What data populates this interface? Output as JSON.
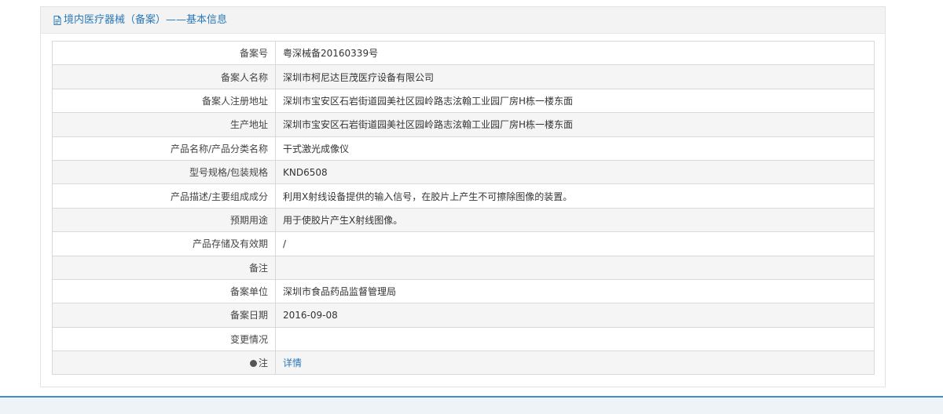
{
  "header": {
    "title": "境内医疗器械（备案）——基本信息",
    "icon": "document-icon",
    "title_color": "#2a78b8"
  },
  "rows": [
    {
      "label": "备案号",
      "value": "粤深械备20160339号"
    },
    {
      "label": "备案人名称",
      "value": "深圳市柯尼达巨茂医疗设备有限公司"
    },
    {
      "label": "备案人注册地址",
      "value": "深圳市宝安区石岩街道园美社区园岭路志泫翰工业园厂房H栋一楼东面"
    },
    {
      "label": "生产地址",
      "value": "深圳市宝安区石岩街道园美社区园岭路志泫翰工业园厂房H栋一楼东面"
    },
    {
      "label": "产品名称/产品分类名称",
      "value": "干式激光成像仪"
    },
    {
      "label": "型号规格/包装规格",
      "value": "KND6508"
    },
    {
      "label": "产品描述/主要组成成分",
      "value": "利用X射线设备提供的输入信号，在胶片上产生不可擦除图像的装置。"
    },
    {
      "label": "预期用途",
      "value": "用于使胶片产生X射线图像。"
    },
    {
      "label": "产品存储及有效期",
      "value": "/"
    },
    {
      "label": "备注",
      "value": ""
    },
    {
      "label": "备案单位",
      "value": "深圳市食品药品监督管理局"
    },
    {
      "label": "备案日期",
      "value": "2016-09-08"
    },
    {
      "label": "变更情况",
      "value": ""
    }
  ],
  "note_row": {
    "label": "注",
    "icon": "note-dot-icon",
    "link_label": "详情",
    "link_color": "#2a78b8"
  },
  "colors": {
    "accent": "#3f8fcf",
    "row_alt": "#f5f5f5",
    "border": "#d9d9d9"
  }
}
